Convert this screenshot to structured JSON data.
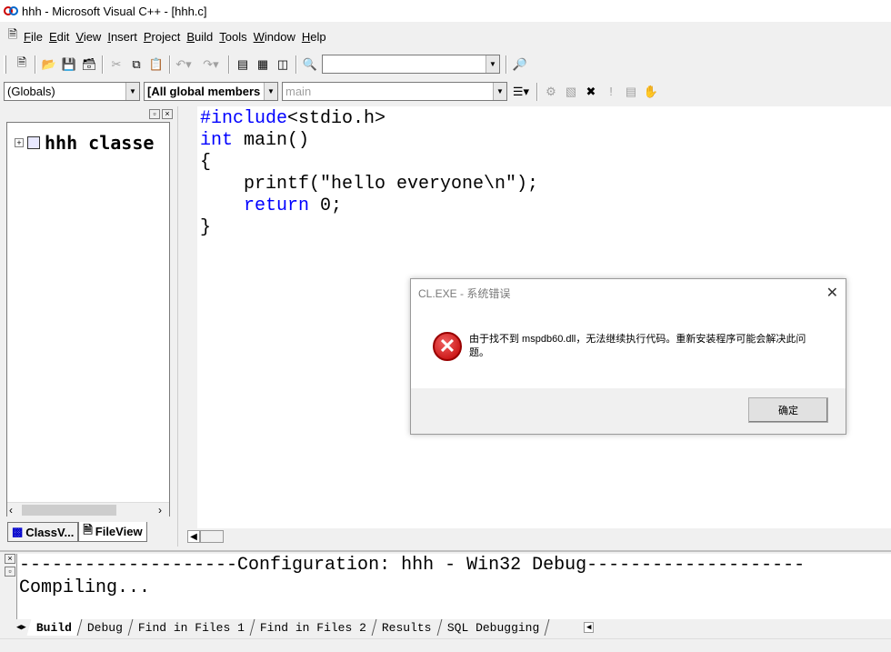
{
  "window": {
    "title": "hhh - Microsoft Visual C++ - [hhh.c]"
  },
  "menu": {
    "items": [
      {
        "label": "File",
        "u": "F",
        "rest": "ile"
      },
      {
        "label": "Edit",
        "u": "E",
        "rest": "dit"
      },
      {
        "label": "View",
        "u": "V",
        "rest": "iew"
      },
      {
        "label": "Insert",
        "u": "I",
        "rest": "nsert"
      },
      {
        "label": "Project",
        "u": "P",
        "rest": "roject"
      },
      {
        "label": "Build",
        "u": "B",
        "rest": "uild"
      },
      {
        "label": "Tools",
        "u": "T",
        "rest": "ools"
      },
      {
        "label": "Window",
        "u": "W",
        "rest": "indow"
      },
      {
        "label": "Help",
        "u": "H",
        "rest": "elp"
      }
    ]
  },
  "wizardbar": {
    "scope": "(Globals)",
    "members": "[All global members",
    "function": "main"
  },
  "classview": {
    "root": "hhh classe",
    "tabs": [
      "ClassV...",
      "FileView"
    ]
  },
  "editor": {
    "lines": [
      {
        "kw": "#include",
        "text": "<stdio.h>"
      },
      {
        "kw": "int",
        "text": " main()"
      },
      {
        "kw": "",
        "text": "{"
      },
      {
        "kw": "",
        "text": "    printf(\"hello everyone\\n\");"
      },
      {
        "kw": "return",
        "text": " 0;",
        "indent": "    "
      },
      {
        "kw": "",
        "text": "}"
      }
    ]
  },
  "output": {
    "lines": [
      "--------------------Configuration: hhh - Win32 Debug--------------------",
      "Compiling..."
    ],
    "tabs": [
      "Build",
      "Debug",
      "Find in Files 1",
      "Find in Files 2",
      "Results",
      "SQL Debugging"
    ]
  },
  "dialog": {
    "title": "CL.EXE - 系统错误",
    "message": "由于找不到 mspdb60.dll，无法继续执行代码。重新安装程序可能会解决此问题。",
    "ok_label": "确定"
  },
  "colors": {
    "keyword": "#0000ff",
    "error": "#c00000"
  }
}
